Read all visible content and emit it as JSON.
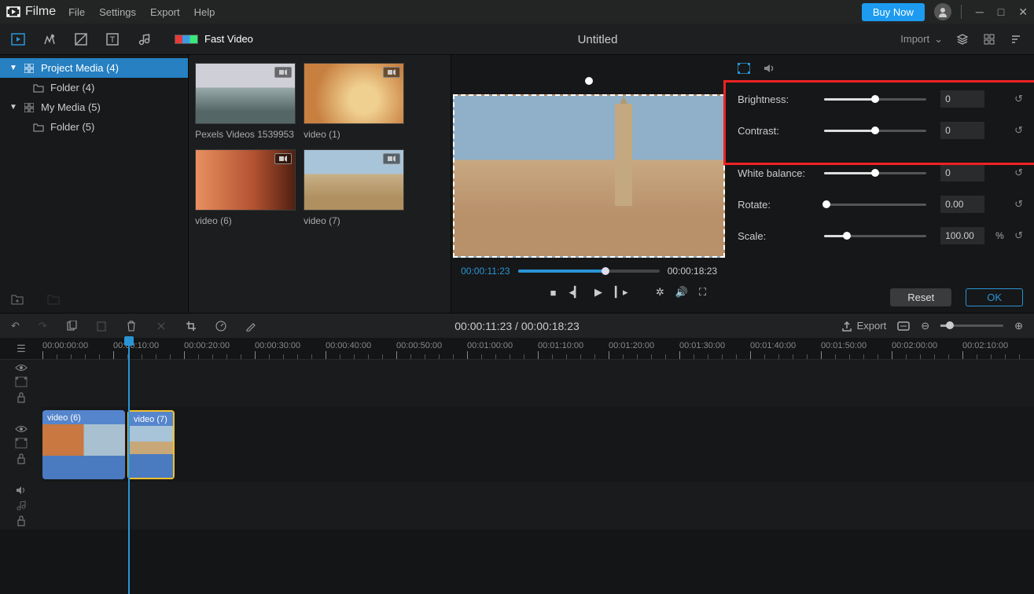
{
  "app": {
    "name": "Filme"
  },
  "menu": {
    "file": "File",
    "settings": "Settings",
    "export": "Export",
    "help": "Help"
  },
  "titlebar": {
    "buy": "Buy Now"
  },
  "toolrow": {
    "fastvideo": "Fast Video",
    "import": "Import"
  },
  "project": {
    "title": "Untitled"
  },
  "sidebar": {
    "project_media": "Project Media (4)",
    "folder1": "Folder (4)",
    "my_media": "My Media (5)",
    "folder2": "Folder (5)"
  },
  "media": {
    "items": [
      {
        "label": "Pexels Videos 1539953"
      },
      {
        "label": "video (1)"
      },
      {
        "label": "video (6)"
      },
      {
        "label": "video (7)"
      }
    ]
  },
  "preview": {
    "current": "00:00:11:23",
    "total": "00:00:18:23"
  },
  "props": {
    "brightness": {
      "label": "Brightness:",
      "value": "0"
    },
    "contrast": {
      "label": "Contrast:",
      "value": "0"
    },
    "white": {
      "label": "White balance:",
      "value": "0"
    },
    "rotate": {
      "label": "Rotate:",
      "value": "0.00"
    },
    "scale": {
      "label": "Scale:",
      "value": "100.00",
      "unit": "%"
    },
    "reset": "Reset",
    "ok": "OK"
  },
  "tl_toolbar": {
    "time": "00:00:11:23 / 00:00:18:23",
    "export": "Export"
  },
  "ruler": {
    "labels": [
      "00:00:00:00",
      "00:00:10:00",
      "00:00:20:00",
      "00:00:30:00",
      "00:00:40:00",
      "00:00:50:00",
      "00:01:00:00",
      "00:01:10:00",
      "00:01:20:00",
      "00:01:30:00",
      "00:01:40:00",
      "00:01:50:00",
      "00:02:00:00",
      "00:02:10:00"
    ]
  },
  "clips": {
    "c1": "video (6)",
    "c2": "video (7)"
  }
}
